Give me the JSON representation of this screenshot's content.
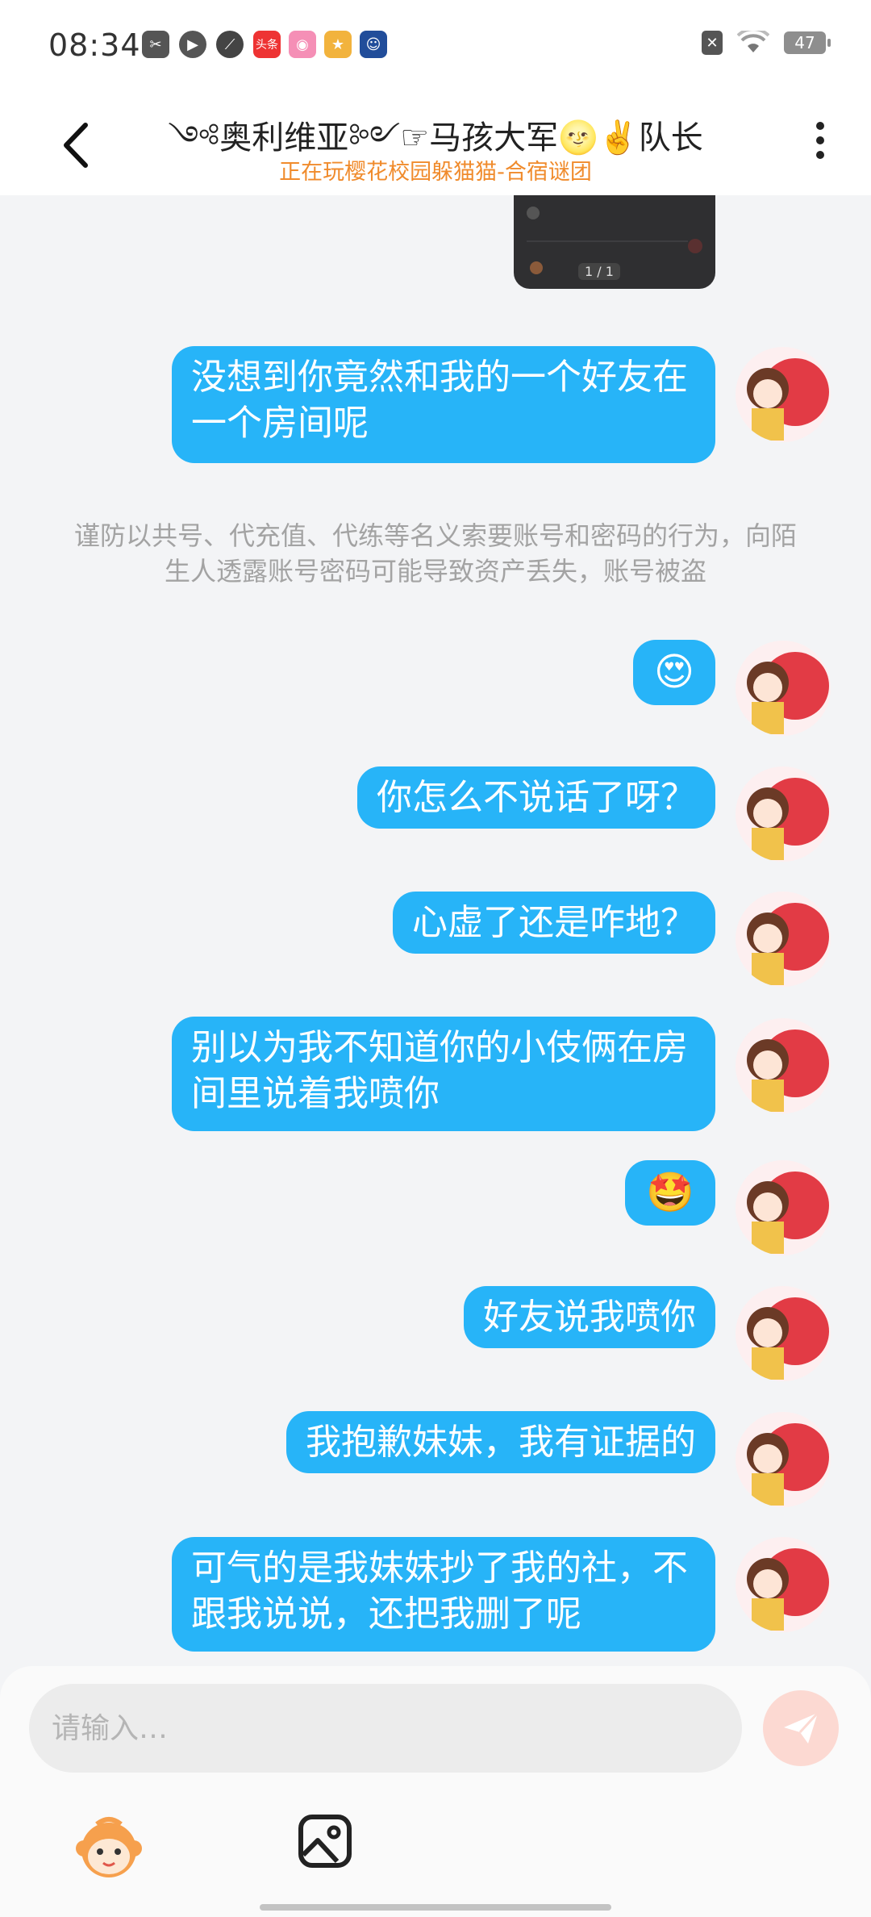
{
  "status_bar": {
    "time": "08:34",
    "battery": "47",
    "left_icons": [
      "recorder-app-icon",
      "video-app-icon",
      "link-app-icon",
      "toutiao-app-icon",
      "camera-app-icon",
      "game-app-icon",
      "chat-app-icon"
    ],
    "toutiao_label": "头条"
  },
  "header": {
    "title": "༺奥利维亚༻☞马孩大军🌝✌️队长",
    "subtitle": "正在玩樱花校园躲猫猫-合宿谜团"
  },
  "card_preview": {
    "counter": "1 / 1"
  },
  "messages": [
    {
      "text": "没想到你竟然和我的一个好友在一个房间呢"
    },
    {
      "text": "😍"
    },
    {
      "text": "你怎么不说话了呀？"
    },
    {
      "text": "心虚了还是咋地？"
    },
    {
      "text": "别以为我不知道你的小伎俩在房间里说着我喷你"
    },
    {
      "text": "🤩"
    },
    {
      "text": "好友说我喷你"
    },
    {
      "text": "我抱歉妹妹，我有证据的"
    },
    {
      "text": "可气的是我妹妹抄了我的社，不跟我说说，还把我删了呢"
    }
  ],
  "notice": "谨防以共号、代充值、代练等名义索要账号和密码的行为，向陌生人透露账号密码可能导致资产丢失，账号被盗",
  "input": {
    "placeholder": "请输入…",
    "value": ""
  },
  "colors": {
    "bubble": "#27b4f8",
    "subtitle": "#f08b2c",
    "send_button": "#fcd9d2",
    "background": "#f3f4f6"
  }
}
